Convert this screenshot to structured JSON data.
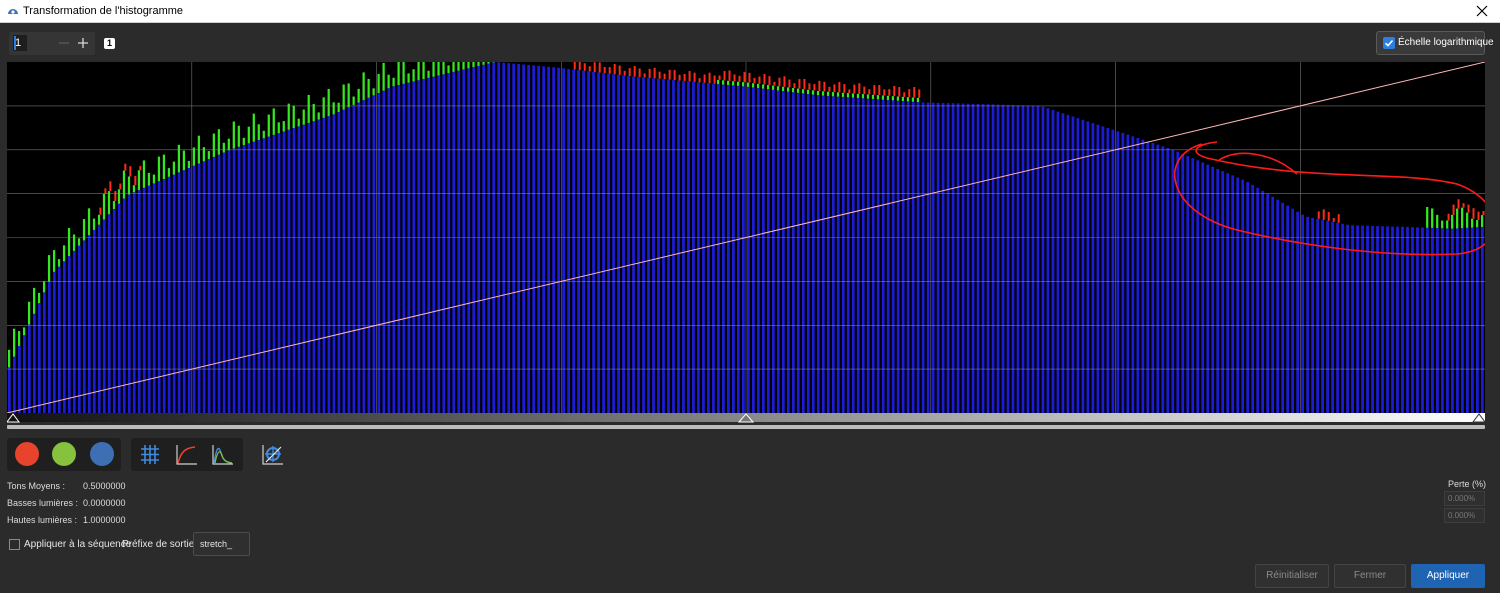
{
  "window": {
    "title": "Transformation de l'histogramme",
    "icon": "siril-icon",
    "close_icon": "close-icon"
  },
  "toolbar": {
    "spin_value": "1",
    "spin_count_badge": "1",
    "log_scale_label": "Échelle logarithmique",
    "log_scale_checked": true
  },
  "histogram": {
    "channel_colors": {
      "red": "#ff2b1a",
      "green": "#33e81e",
      "blue": "#1c1cd6"
    },
    "curve_color": "#ffb8b8",
    "grid": true,
    "log_scale": true,
    "midtone_slider": 0.5,
    "annotation_color": "#ff1a1a"
  },
  "channels": {
    "red": {
      "name": "red-channel",
      "color": "#e8432d"
    },
    "green": {
      "name": "green-channel",
      "color": "#86c23e"
    },
    "blue": {
      "name": "blue-channel",
      "color": "#3f6fb3"
    }
  },
  "params": {
    "midtones_label": "Tons Moyens :",
    "midtones_value": "0.5000000",
    "shadows_label": "Basses lumières :",
    "shadows_value": "0.0000000",
    "highlights_label": "Hautes lumières :",
    "highlights_value": "1.0000000"
  },
  "sequence": {
    "apply_label": "Appliquer à la séquence",
    "apply_checked": false,
    "prefix_label": "Préfixe de sortie :",
    "prefix_value": "stretch_"
  },
  "loss": {
    "label": "Perte (%)",
    "low": "0.000%",
    "high": "0.000%"
  },
  "buttons": {
    "reset": "Réinitialiser",
    "close": "Fermer",
    "apply": "Appliquer"
  }
}
